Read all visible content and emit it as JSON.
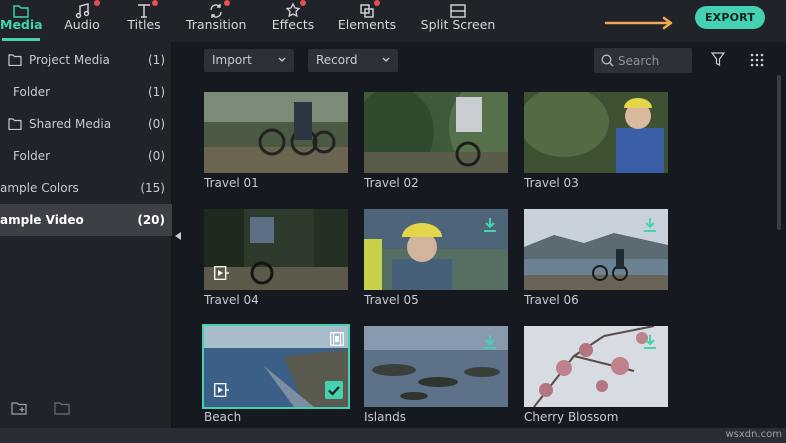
{
  "toolbar": {
    "tabs": [
      {
        "label": "Media",
        "icon": "folder-icon",
        "active": true
      },
      {
        "label": "Audio",
        "icon": "music-note-icon",
        "badge": true
      },
      {
        "label": "Titles",
        "icon": "title-t-icon",
        "badge": true
      },
      {
        "label": "Transition",
        "icon": "transition-icon",
        "badge": true
      },
      {
        "label": "Effects",
        "icon": "effects-icon",
        "badge": true
      },
      {
        "label": "Elements",
        "icon": "elements-icon",
        "badge": true
      },
      {
        "label": "Split Screen",
        "icon": "split-screen-icon"
      }
    ],
    "export_label": "EXPORT",
    "accent_color": "#45d2b1",
    "badge_color": "#e8504f",
    "arrow_color": "#f0a850"
  },
  "sidebar": {
    "items": [
      {
        "label": "Project Media",
        "count": "(1)",
        "folder_icon": true
      },
      {
        "label": "Folder",
        "count": "(1)"
      },
      {
        "label": "Shared Media",
        "count": "(0)",
        "folder_icon": true
      },
      {
        "label": "Folder",
        "count": "(0)"
      },
      {
        "label": "ample Colors",
        "count": "(15)"
      },
      {
        "label": "ample Video",
        "count": "(20)",
        "selected": true
      }
    ]
  },
  "content": {
    "import_label": "Import",
    "record_label": "Record",
    "search_placeholder": "Search",
    "tiles": [
      {
        "caption": "Travel 01"
      },
      {
        "caption": "Travel 02"
      },
      {
        "caption": "Travel 03"
      },
      {
        "caption": "Travel 04",
        "video_badge": true
      },
      {
        "caption": "Travel 05",
        "download_badge": true
      },
      {
        "caption": "Travel 06",
        "download_badge": true
      },
      {
        "caption": "Beach",
        "video_badge": true,
        "selected": true,
        "checked": true
      },
      {
        "caption": "Islands",
        "download_badge": true
      },
      {
        "caption": "Cherry Blossom",
        "download_badge": true
      }
    ]
  },
  "watermark": "wsxdn.com"
}
